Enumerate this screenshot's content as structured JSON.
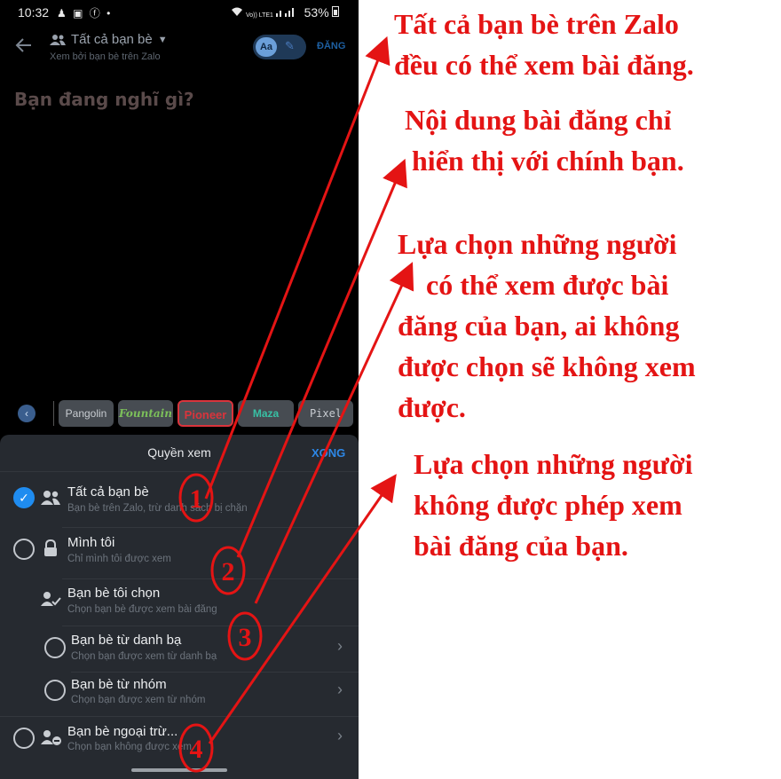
{
  "status_bar": {
    "time": "10:32",
    "notification_icons": "♟ ▣ ⓕ •",
    "carrier": "Vo)) LTE1",
    "battery": "53%"
  },
  "header": {
    "title": "Tất cả bạn bè",
    "subtitle": "Xem bởi bạn bè trên Zalo",
    "style_toggle_label": "Aa",
    "post_button": "ĐĂNG"
  },
  "composer": {
    "placeholder": "Bạn đang nghĩ gì?"
  },
  "font_styles": [
    "Pangolin",
    "Fountain",
    "Pioneer",
    "Maza",
    "Pixel"
  ],
  "sheet": {
    "title": "Quyền xem",
    "done": "XONG",
    "options": [
      {
        "label": "Tất cả bạn bè",
        "sub": "Bạn bè trên Zalo, trừ danh sách bị chặn"
      },
      {
        "label": "Mình tôi",
        "sub": "Chỉ mình tôi được xem"
      },
      {
        "label": "Bạn bè tôi chọn",
        "sub": "Chọn bạn bè được xem bài đăng"
      },
      {
        "label": "Bạn bè từ danh bạ",
        "sub": "Chọn bạn được xem từ danh bạ"
      },
      {
        "label": "Bạn bè từ nhóm",
        "sub": "Chọn bạn được xem từ nhóm"
      },
      {
        "label": "Bạn bè ngoại trừ...",
        "sub": "Chọn bạn không được xem"
      }
    ]
  },
  "annotations": {
    "markers": [
      "1",
      "2",
      "3",
      "4"
    ],
    "notes": [
      "Tất cả bạn bè trên Zalo\nđều có thể xem bài đăng.",
      "Nội dung bài đăng chỉ\n hiển thị với chính bạn.",
      "Lựa chọn những người\n    có thể xem được bài\nđăng của bạn, ai không\nđược chọn sẽ không xem\nđược.",
      "Lựa chọn những người\nkhông được phép xem\nbài đăng của bạn."
    ],
    "color": "#e41414"
  }
}
